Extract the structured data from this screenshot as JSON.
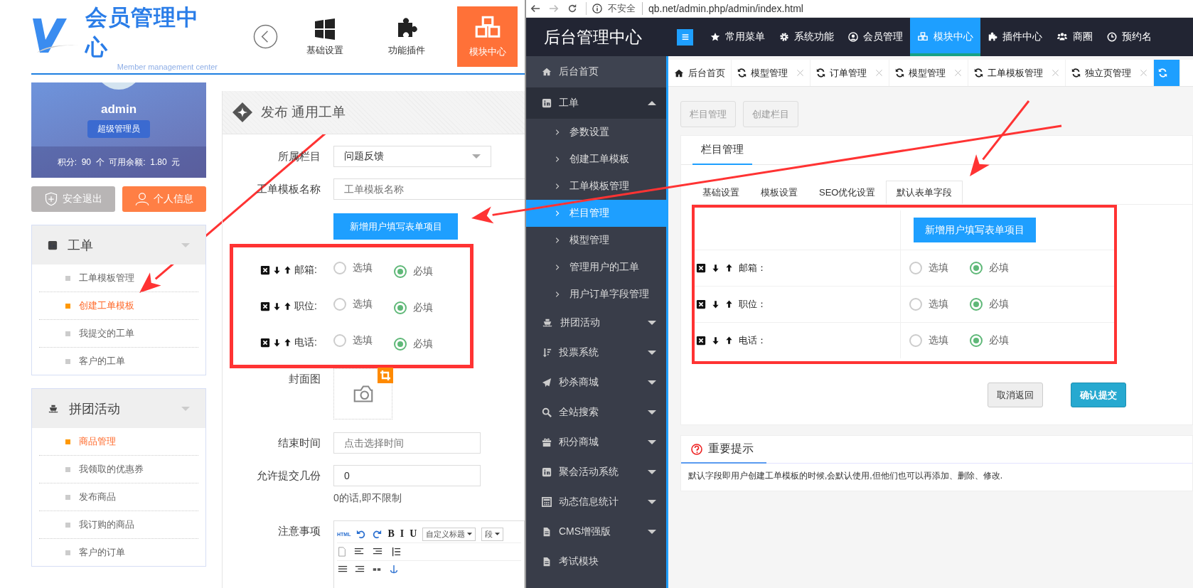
{
  "left_app": {
    "logo": {
      "title": "会员管理中心",
      "subtitle": "Member management center"
    },
    "top_nav": [
      {
        "label": "基础设置",
        "selected": false
      },
      {
        "label": "功能插件",
        "selected": false
      },
      {
        "label": "模块中心",
        "selected": true
      }
    ],
    "user": {
      "name": "admin",
      "role": "超级管理员",
      "stats": "积分:  90  个  可用余额:  1.80  元"
    },
    "buttons": [
      {
        "label": "安全退出",
        "kind": "logout"
      },
      {
        "label": "个人信息",
        "kind": "profile"
      }
    ],
    "menu_groups": [
      {
        "label": "工单",
        "items": [
          {
            "label": "工单模板管理",
            "selected": false
          },
          {
            "label": "创建工单模板",
            "selected": true
          },
          {
            "label": "我提交的工单",
            "selected": false
          },
          {
            "label": "客户的工单",
            "selected": false
          }
        ]
      },
      {
        "label": "拼团活动",
        "items": [
          {
            "label": "商品管理",
            "selected": true
          },
          {
            "label": "我领取的优惠券",
            "selected": false
          },
          {
            "label": "发布商品",
            "selected": false
          },
          {
            "label": "我订购的商品",
            "selected": false
          },
          {
            "label": "客户的订单",
            "selected": false
          }
        ]
      }
    ],
    "form": {
      "title": "发布 通用工单",
      "category": {
        "label": "所属栏目",
        "value": "问题反馈"
      },
      "template_name": {
        "label": "工单模板名称",
        "placeholder": "工单模板名称"
      },
      "add_button": "新增用户填写表单项目",
      "fields": [
        {
          "label": "邮箱:",
          "options": [
            {
              "label": "选填",
              "selected": false
            },
            {
              "label": "必填",
              "selected": true
            }
          ]
        },
        {
          "label": "职位:",
          "options": [
            {
              "label": "选填",
              "selected": false
            },
            {
              "label": "必填",
              "selected": true
            }
          ]
        },
        {
          "label": "电话:",
          "options": [
            {
              "label": "选填",
              "selected": false
            },
            {
              "label": "必填",
              "selected": true
            }
          ]
        }
      ],
      "cover": {
        "label": "封面图"
      },
      "end_time": {
        "label": "结束时间",
        "placeholder": "点击选择时间"
      },
      "max_submissions": {
        "label": "允许提交几份",
        "value": "0",
        "hint": "0的话,即不限制"
      },
      "notes": {
        "label": "注意事项",
        "toolbar": [
          {
            "text": "HTML",
            "kind": "tag"
          },
          {
            "text": "B",
            "kind": "button"
          },
          {
            "text": "I",
            "kind": "button"
          },
          {
            "text": "U",
            "kind": "button"
          },
          {
            "text": "自定义标题",
            "kind": "dropdown"
          },
          {
            "text": "段",
            "kind": "dropdown"
          }
        ]
      }
    }
  },
  "right_app": {
    "address_bar": {
      "security": "不安全",
      "url": "qb.net/admin.php/admin/index.html"
    },
    "brand": "后台管理中心",
    "top_nav": [
      {
        "label": "常用菜单",
        "selected": false
      },
      {
        "label": "系统功能",
        "selected": false
      },
      {
        "label": "会员管理",
        "selected": false
      },
      {
        "label": "模块中心",
        "selected": true
      },
      {
        "label": "插件中心",
        "selected": false
      },
      {
        "label": "商圈",
        "selected": false
      },
      {
        "label": "预约名",
        "selected": false
      }
    ],
    "sidebar": [
      {
        "label": "后台首页",
        "selected": false
      },
      {
        "label": "工单",
        "selected": false,
        "expanded": true,
        "children": [
          {
            "label": "参数设置",
            "selected": false
          },
          {
            "label": "创建工单模板",
            "selected": false
          },
          {
            "label": "工单模板管理",
            "selected": false
          },
          {
            "label": "栏目管理",
            "selected": true
          },
          {
            "label": "模型管理",
            "selected": false
          },
          {
            "label": "管理用户的工单",
            "selected": false
          },
          {
            "label": "用户订单字段管理",
            "selected": false
          }
        ]
      },
      {
        "label": "拼团活动",
        "selected": false,
        "expanded": false
      },
      {
        "label": "投票系统",
        "selected": false,
        "expanded": false
      },
      {
        "label": "秒杀商城",
        "selected": false,
        "expanded": false
      },
      {
        "label": "全站搜索",
        "selected": false,
        "expanded": false
      },
      {
        "label": "积分商城",
        "selected": false,
        "expanded": false
      },
      {
        "label": "聚会活动系统",
        "selected": false,
        "expanded": false
      },
      {
        "label": "动态信息统计",
        "selected": false,
        "expanded": false
      },
      {
        "label": "CMS增强版",
        "selected": false,
        "expanded": false
      },
      {
        "label": "考试模块",
        "selected": false
      }
    ],
    "page_tabs": [
      {
        "label": "后台首页",
        "selected": false,
        "closable": false
      },
      {
        "label": "模型管理",
        "selected": false,
        "closable": true
      },
      {
        "label": "订单管理",
        "selected": false,
        "closable": true
      },
      {
        "label": "模型管理",
        "selected": false,
        "closable": true
      },
      {
        "label": "工单模板管理",
        "selected": false,
        "closable": true
      },
      {
        "label": "独立页管理",
        "selected": false,
        "closable": true
      },
      {
        "selected": true,
        "closable": false
      }
    ],
    "toolbar_buttons": [
      "栏目管理",
      "创建栏目"
    ],
    "panel_title": "栏目管理",
    "sub_tabs": [
      {
        "label": "基础设置",
        "selected": false
      },
      {
        "label": "模板设置",
        "selected": false
      },
      {
        "label": "SEO优化设置",
        "selected": false
      },
      {
        "label": "默认表单字段",
        "selected": true
      }
    ],
    "add_button": "新增用户填写表单项目",
    "fields": [
      {
        "label": "邮箱：",
        "options": [
          {
            "label": "选填",
            "selected": false
          },
          {
            "label": "必填",
            "selected": true
          }
        ]
      },
      {
        "label": "职位：",
        "options": [
          {
            "label": "选填",
            "selected": false
          },
          {
            "label": "必填",
            "selected": true
          }
        ]
      },
      {
        "label": "电话：",
        "options": [
          {
            "label": "选填",
            "selected": false
          },
          {
            "label": "必填",
            "selected": true
          }
        ]
      }
    ],
    "actions": [
      {
        "label": "取消返回",
        "kind": "default"
      },
      {
        "label": "确认提交",
        "kind": "primary"
      }
    ],
    "notice": {
      "title": "重要提示",
      "text": "默认字段即用户创建工单模板的时候,会默认使用,但他们也可以再添加、删除、修改."
    }
  }
}
